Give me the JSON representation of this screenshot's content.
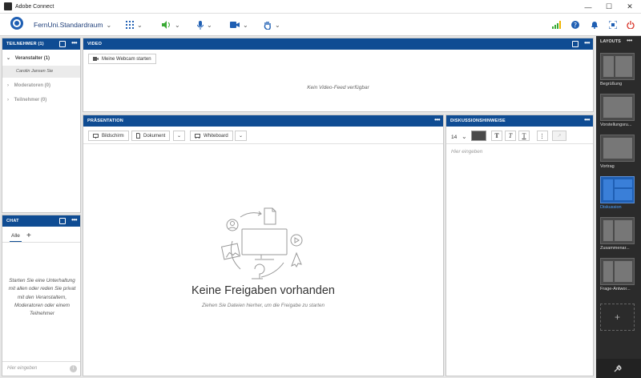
{
  "window": {
    "title": "Adobe Connect"
  },
  "toolbar": {
    "room_name": "FernUni.Standardraum"
  },
  "attendees": {
    "header": "TEILNEHMER (1)",
    "groups": [
      {
        "label": "Veranstalter (1)"
      },
      {
        "label": "Moderatoren (0)"
      },
      {
        "label": "Teilnehmer (0)"
      }
    ],
    "host_name": "Carolin Jansen",
    "host_suffix": "Sie"
  },
  "chat": {
    "header": "CHAT",
    "tab_all": "Alle",
    "add_tab": "+",
    "empty_message": "Starten Sie eine Unterhaltung mit allen oder reden Sie privat mit den Veranstaltern, Moderatoren oder einem Teilnehmer",
    "input_placeholder": "Hier eingeben"
  },
  "video": {
    "header": "VIDEO",
    "start_webcam": "Meine Webcam starten",
    "no_feed": "Kein Video-Feed verfügbar"
  },
  "presentation": {
    "header": "PRÄSENTATION",
    "btn_screen": "Bildschirm",
    "btn_document": "Dokument",
    "btn_whiteboard": "Whiteboard",
    "empty_title": "Keine Freigaben vorhanden",
    "empty_hint": "Ziehen Sie Dateien hierher, um die Freigabe zu starten"
  },
  "notes": {
    "header": "DISKUSSIONSHINWEISE",
    "font_size": "14",
    "placeholder": "Hier eingeben"
  },
  "layouts": {
    "header": "LAYOUTS",
    "items": [
      {
        "label": "Begrüßung"
      },
      {
        "label": "Vorstellungsru..."
      },
      {
        "label": "Vortrag"
      },
      {
        "label": "Diskussion"
      },
      {
        "label": "Zusammenar..."
      },
      {
        "label": "Frage-Antwor..."
      }
    ],
    "add": "+"
  },
  "colors": {
    "accent": "#0f4c93",
    "selected_layout": "#1f5fb3",
    "power": "#d9362b",
    "signal": "#3aaa35"
  }
}
